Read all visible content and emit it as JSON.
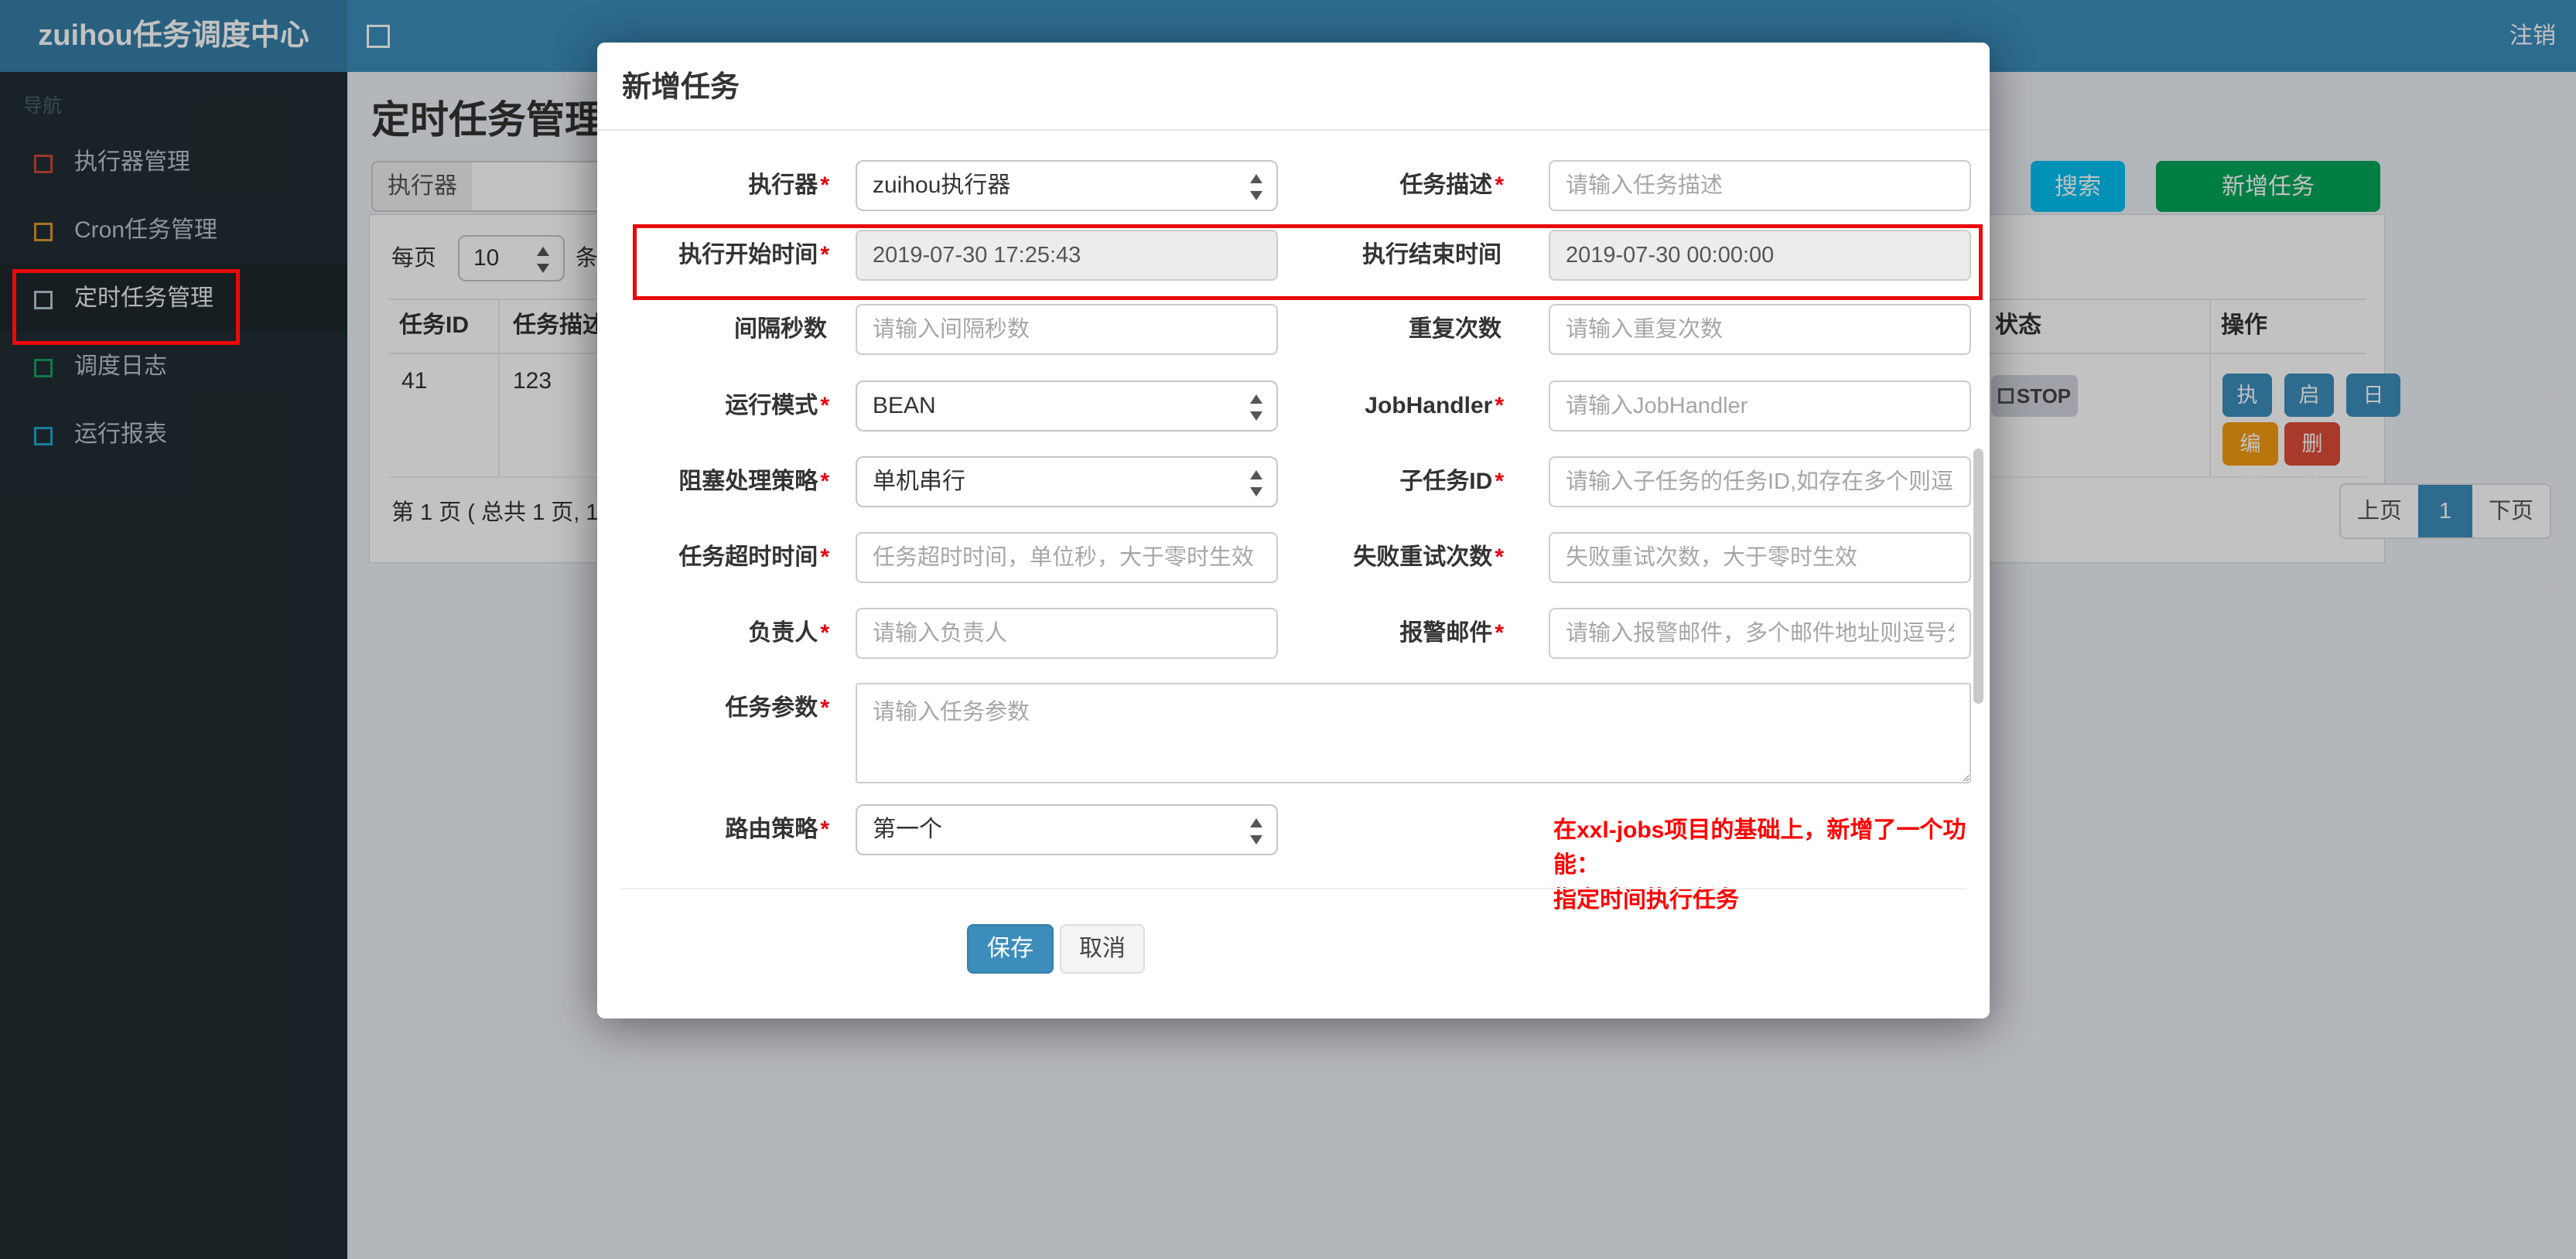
{
  "header": {
    "brand": "zuihou任务调度中心",
    "logout": "注销"
  },
  "sidebar": {
    "nav_label": "导航",
    "items": [
      {
        "label": "执行器管理",
        "icon_color": "#c9493b",
        "active": false
      },
      {
        "label": "Cron任务管理",
        "icon_color": "#d9972f",
        "active": false
      },
      {
        "label": "定时任务管理",
        "icon_color": "#b8c7ce",
        "active": true
      },
      {
        "label": "调度日志",
        "icon_color": "#1a9e61",
        "active": false
      },
      {
        "label": "运行报表",
        "icon_color": "#1fa8c9",
        "active": false
      }
    ]
  },
  "page": {
    "title": "定时任务管理",
    "filter": {
      "executor_label": "执行器",
      "search_button": "搜索",
      "search_color": "#00c0ef",
      "add_button": "新增任务",
      "add_color": "#00a65a"
    },
    "per_page": {
      "prefix": "每页",
      "value": "10",
      "suffix": "条记录"
    },
    "table": {
      "headers": [
        "任务ID",
        "任务描述",
        "状态",
        "操作"
      ],
      "row": {
        "job_id": "41",
        "job_desc": "123",
        "status_label": "STOP",
        "op_buttons": [
          {
            "label": "执行",
            "color": "#3c8dbc"
          },
          {
            "label": "启动",
            "color": "#3c8dbc"
          },
          {
            "label": "日志",
            "color": "#3c8dbc"
          },
          {
            "label": "编辑",
            "color": "#f39c12"
          },
          {
            "label": "删除",
            "color": "#dd4b39"
          }
        ]
      }
    },
    "pagination": {
      "summary": "第 1 页 ( 总共 1 页, 1",
      "prev": "上页",
      "current": "1",
      "next": "下页"
    }
  },
  "modal": {
    "title": "新增任务",
    "fields": {
      "executor": {
        "label": "执行器",
        "star": "*",
        "value": "zuihou执行器"
      },
      "job_desc": {
        "label": "任务描述",
        "star": "*",
        "placeholder": "请输入任务描述"
      },
      "start_time": {
        "label": "执行开始时间",
        "star": "*",
        "value": "2019-07-30 17:25:43"
      },
      "end_time": {
        "label": "执行结束时间",
        "star": "",
        "value": "2019-07-30 00:00:00"
      },
      "interval": {
        "label": "间隔秒数",
        "star": "",
        "placeholder": "请输入间隔秒数"
      },
      "repeat_count": {
        "label": "重复次数",
        "star": "",
        "placeholder": "请输入重复次数"
      },
      "run_mode": {
        "label": "运行模式",
        "star": "*",
        "value": "BEAN"
      },
      "job_handler": {
        "label": "JobHandler",
        "star": "*",
        "placeholder": "请输入JobHandler"
      },
      "block_strategy": {
        "label": "阻塞处理策略",
        "star": "*",
        "value": "单机串行"
      },
      "child_job_id": {
        "label": "子任务ID",
        "star": "*",
        "placeholder": "请输入子任务的任务ID,如存在多个则逗号分隔"
      },
      "timeout": {
        "label": "任务超时时间",
        "star": "*",
        "placeholder": "任务超时时间，单位秒，大于零时生效"
      },
      "fail_retry": {
        "label": "失败重试次数",
        "star": "*",
        "placeholder": "失败重试次数，大于零时生效"
      },
      "owner": {
        "label": "负责人",
        "star": "*",
        "placeholder": "请输入负责人"
      },
      "alarm_email": {
        "label": "报警邮件",
        "star": "*",
        "placeholder": "请输入报警邮件，多个邮件地址则逗号分隔"
      },
      "job_param": {
        "label": "任务参数",
        "star": "*",
        "placeholder": "请输入任务参数"
      },
      "route_strategy": {
        "label": "路由策略",
        "star": "*",
        "value": "第一个"
      }
    },
    "note": {
      "line1": "在xxl-jobs项目的基础上，新增了一个功能：",
      "line2": "指定时间执行任务",
      "color": "#ff0000"
    },
    "save_button": "保存",
    "cancel_button": "取消"
  },
  "annotations": {
    "box_color": "#ea0a0a"
  }
}
